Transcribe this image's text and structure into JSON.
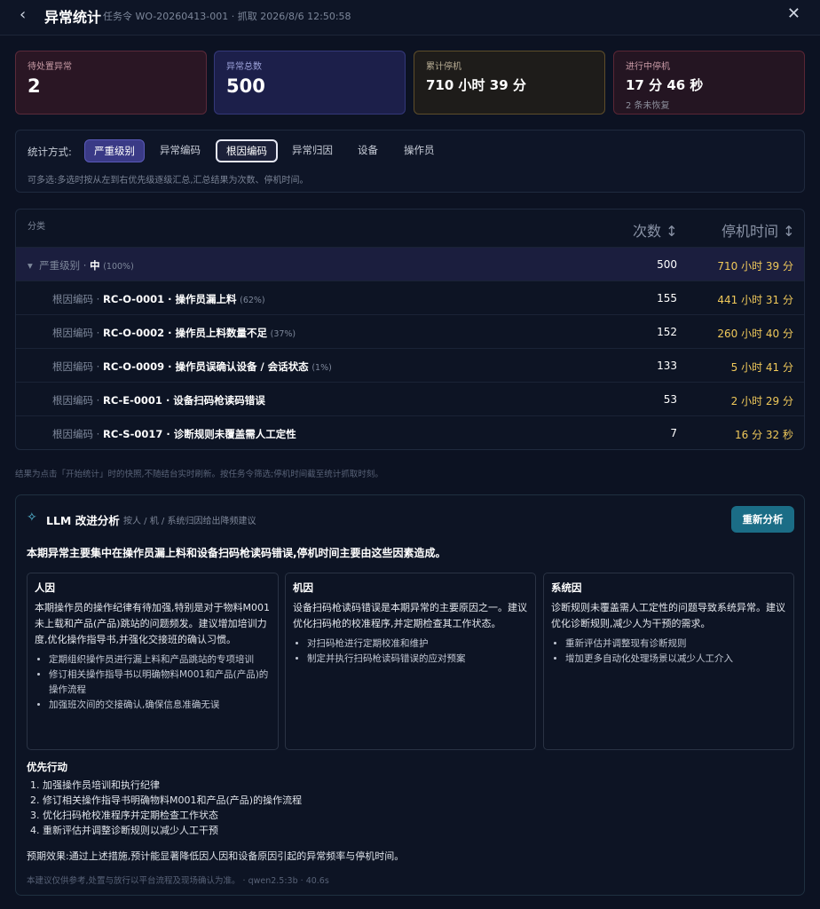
{
  "header": {
    "title": "异常统计",
    "subtitle": "任务令 WO-20260413-001 · 抓取 2026/8/6 12:50:58"
  },
  "cards": [
    {
      "label": "待处置异常",
      "value": "2"
    },
    {
      "label": "异常总数",
      "value": "500"
    },
    {
      "label": "累计停机",
      "value": "710 小时 39 分"
    },
    {
      "label": "进行中停机",
      "value": "17 分 46 秒",
      "note": "2 条未恢复"
    }
  ],
  "stat": {
    "label": "统计方式:",
    "options": [
      "严重级别",
      "异常编码",
      "根因编码",
      "异常归因",
      "设备",
      "操作员"
    ],
    "selected": [
      "严重级别",
      "根因编码"
    ],
    "hint": "可多选:多选时按从左到右优先级逐级汇总,汇总结果为次数、停机时间。"
  },
  "table": {
    "col_category": "分类",
    "col_count": "次数 ↕",
    "col_time": "停机时间 ↕",
    "group": {
      "prefix": "严重级别 ·",
      "name": "中",
      "pct": "(100%)",
      "count": "500",
      "time": "710 小时 39 分"
    },
    "rows": [
      {
        "prefix": "根因编码 ·",
        "name": "RC-O-0001 · 操作员漏上料",
        "pct": "(62%)",
        "count": "155",
        "time": "441 小时 31 分"
      },
      {
        "prefix": "根因编码 ·",
        "name": "RC-O-0002 · 操作员上料数量不足",
        "pct": "(37%)",
        "count": "152",
        "time": "260 小时 40 分"
      },
      {
        "prefix": "根因编码 ·",
        "name": "RC-O-0009 · 操作员误确认设备 / 会话状态",
        "pct": "(1%)",
        "count": "133",
        "time": "5 小时 41 分"
      },
      {
        "prefix": "根因编码 ·",
        "name": "RC-E-0001 · 设备扫码枪读码错误",
        "pct": "",
        "count": "53",
        "time": "2 小时 29 分"
      },
      {
        "prefix": "根因编码 ·",
        "name": "RC-S-0017 · 诊断规则未覆盖需人工定性",
        "pct": "",
        "count": "7",
        "time": "16 分 32 秒"
      }
    ]
  },
  "footnote": "结果为点击「开始统计」时的快照,不随结台实时刷新。按任务令筛选;停机时间截至统计抓取时刻。",
  "llm": {
    "title": "LLM 改进分析",
    "subtitle": "按人 / 机 / 系统归因给出降频建议",
    "button": "重新分析",
    "summary": "本期异常主要集中在操作员漏上料和设备扫码枪读码错误,停机时间主要由这些因素造成。",
    "columns": [
      {
        "title": "人因",
        "text": "本期操作员的操作纪律有待加强,特别是对于物料M001未上载和产品(产品)跳站的问题频发。建议增加培训力度,优化操作指导书,并强化交接班的确认习惯。",
        "items": [
          "定期组织操作员进行漏上料和产品跳站的专项培训",
          "修订相关操作指导书以明确物料M001和产品(产品)的操作流程",
          "加强班次间的交接确认,确保信息准确无误"
        ]
      },
      {
        "title": "机因",
        "text": "设备扫码枪读码错误是本期异常的主要原因之一。建议优化扫码枪的校准程序,并定期检查其工作状态。",
        "items": [
          "对扫码枪进行定期校准和维护",
          "制定并执行扫码枪读码错误的应对预案"
        ]
      },
      {
        "title": "系统因",
        "text": "诊断规则未覆盖需人工定性的问题导致系统异常。建议优化诊断规则,减少人为干预的需求。",
        "items": [
          "重新评估并调整现有诊断规则",
          "增加更多自动化处理场景以减少人工介入"
        ]
      }
    ],
    "actions_title": "优先行动",
    "actions": [
      "加强操作员培训和执行纪律",
      "修订相关操作指导书明确物料M001和产品(产品)的操作流程",
      "优化扫码枪校准程序并定期检查工作状态",
      "重新评估并调整诊断规则以减少人工干预"
    ],
    "effect_label": "预期效果:",
    "effect_text": "通过上述措施,预计能显著降低因人因和设备原因引起的异常频率与停机时间。",
    "disclaimer": "本建议仅供参考,处置与放行以平台流程及现场确认为准。 · qwen2.5:3b · 40.6s"
  },
  "icons": {
    "back": "chevron-left-icon",
    "close": "close-icon",
    "sparkle": "sparkle-icon"
  }
}
